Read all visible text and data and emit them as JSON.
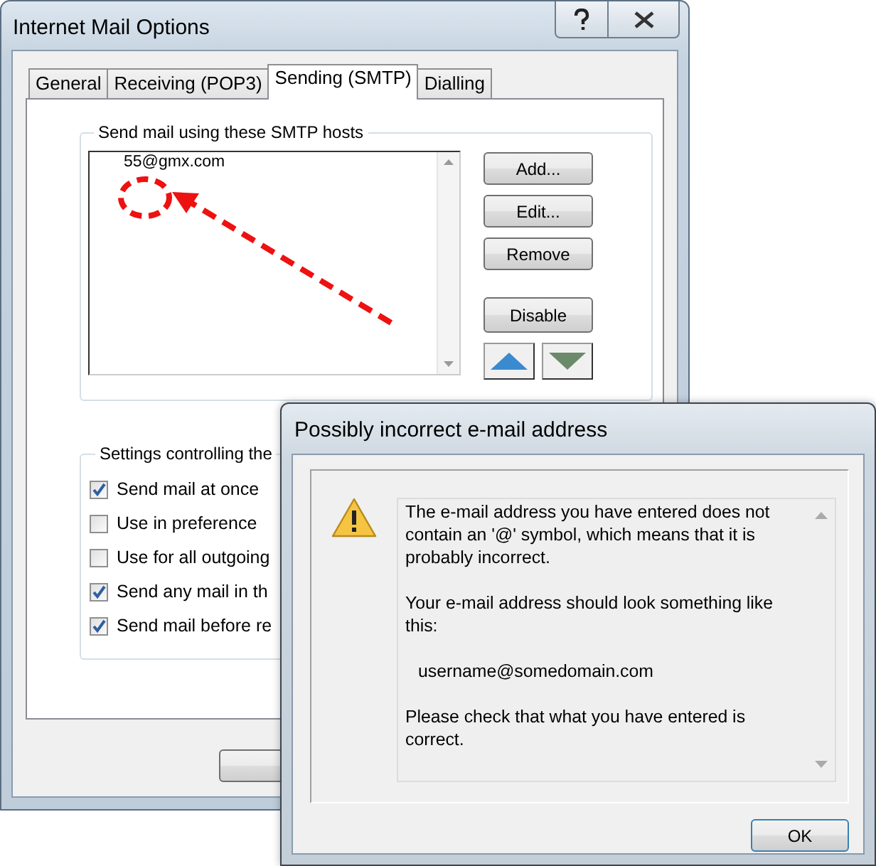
{
  "window": {
    "title": "Internet Mail Options"
  },
  "tabs": [
    {
      "label": "General",
      "selected": false
    },
    {
      "label": "Receiving (POP3)",
      "selected": false
    },
    {
      "label": "Sending (SMTP)",
      "selected": true
    },
    {
      "label": "Dialling",
      "selected": false
    }
  ],
  "smtp_group": {
    "title": "Send mail using these SMTP hosts",
    "hosts": [
      "55@gmx.com"
    ],
    "buttons": [
      "Add...",
      "Edit...",
      "Remove",
      "Disable"
    ]
  },
  "settings_group": {
    "title": "Settings controlling the",
    "options": [
      {
        "label": "Send mail at once",
        "checked": true
      },
      {
        "label": "Use in preference",
        "checked": false
      },
      {
        "label": "Use for all outgoing",
        "checked": false
      },
      {
        "label": "Send any mail in th",
        "checked": true
      },
      {
        "label": "Send mail before re",
        "checked": true
      }
    ]
  },
  "dialog": {
    "title": "Possibly incorrect e-mail address",
    "paragraphs": [
      {
        "kind": "text",
        "text": "The e-mail address you have entered does not contain an '@' symbol, which means that it is probably incorrect."
      },
      {
        "kind": "text",
        "text": "Your e-mail address should look something like this:"
      },
      {
        "kind": "example",
        "text": "username@somedomain.com"
      },
      {
        "kind": "text",
        "text": "Please check that what you have entered is correct."
      }
    ],
    "button": "OK"
  }
}
